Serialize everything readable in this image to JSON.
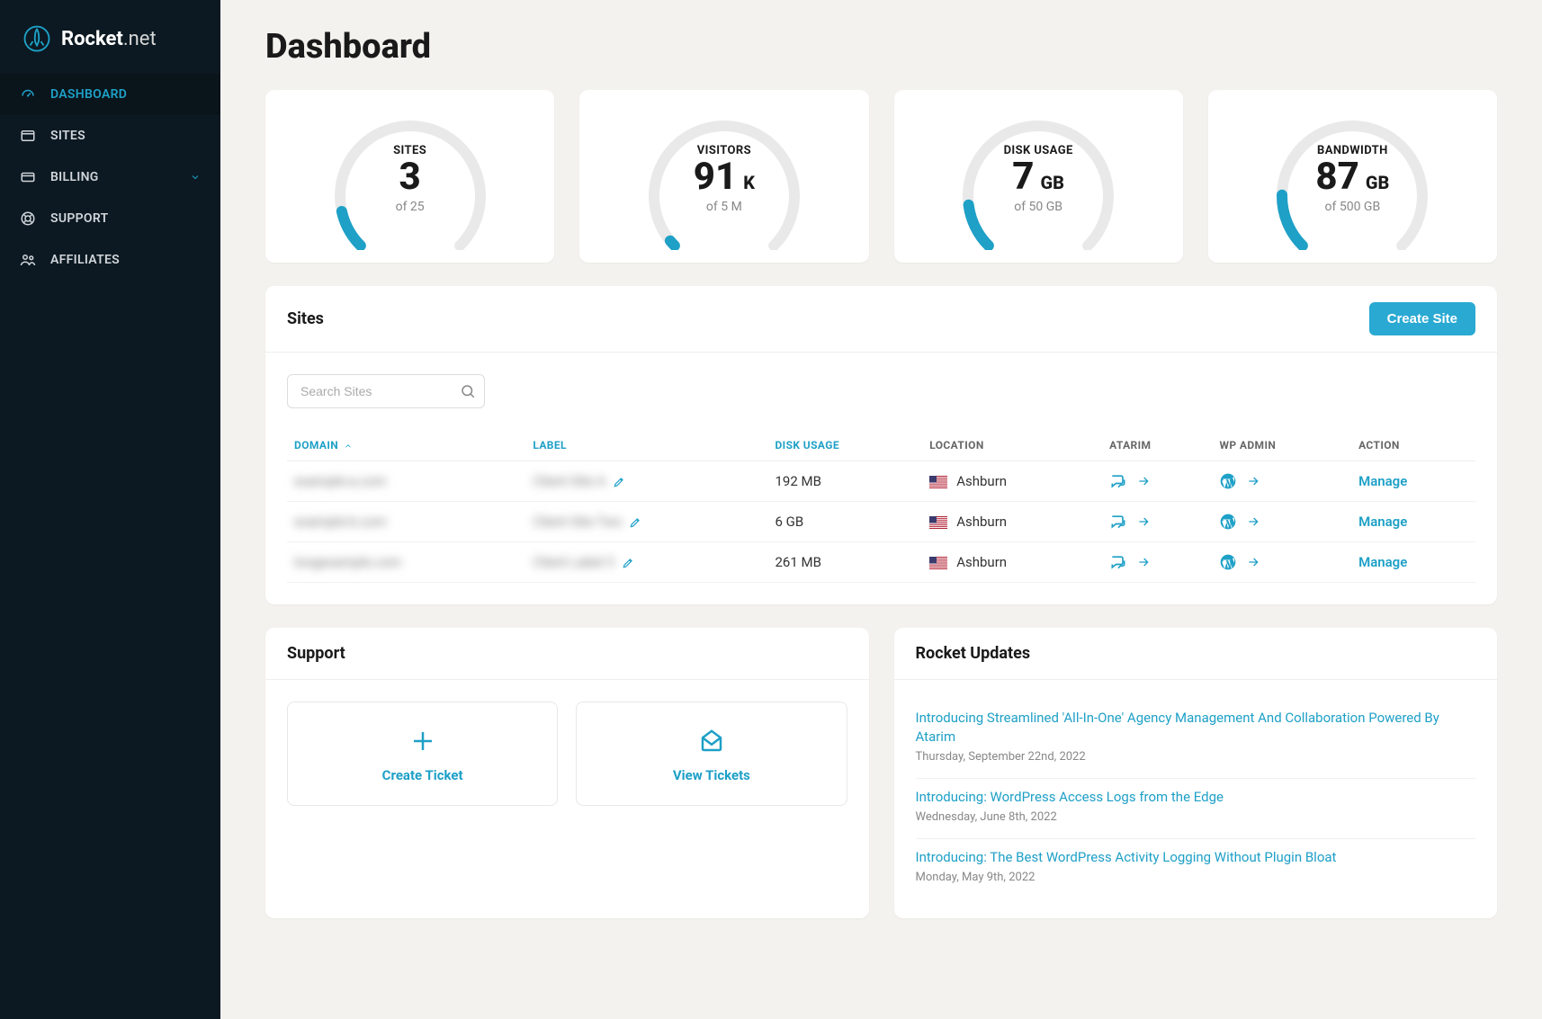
{
  "brand": {
    "name_bold": "Rocket",
    "name_thin": ".net"
  },
  "nav": [
    {
      "label": "DASHBOARD",
      "icon": "gauge",
      "active": true
    },
    {
      "label": "SITES",
      "icon": "window",
      "active": false
    },
    {
      "label": "BILLING",
      "icon": "card",
      "active": false,
      "expandable": true
    },
    {
      "label": "SUPPORT",
      "icon": "lifebuoy",
      "active": false
    },
    {
      "label": "AFFILIATES",
      "icon": "people",
      "active": false
    }
  ],
  "page_title": "Dashboard",
  "chart_data": [
    {
      "type": "gauge",
      "label": "SITES",
      "value": "3",
      "unit": "",
      "sub": "of 25",
      "fraction": 0.12
    },
    {
      "type": "gauge",
      "label": "VISITORS",
      "value": "91",
      "unit": "K",
      "sub": "of 5 M",
      "fraction": 0.02
    },
    {
      "type": "gauge",
      "label": "DISK USAGE",
      "value": "7",
      "unit": "GB",
      "sub": "of 50 GB",
      "fraction": 0.14
    },
    {
      "type": "gauge",
      "label": "BANDWIDTH",
      "value": "87",
      "unit": "GB",
      "sub": "of 500 GB",
      "fraction": 0.17
    }
  ],
  "sites_panel": {
    "title": "Sites",
    "create_btn": "Create Site",
    "search_placeholder": "Search Sites",
    "headers": {
      "domain": "DOMAIN",
      "label": "LABEL",
      "disk": "DISK USAGE",
      "location": "LOCATION",
      "atarim": "ATARIM",
      "wpadmin": "WP ADMIN",
      "action": "ACTION"
    },
    "rows": [
      {
        "domain": "example-a.com",
        "label": "Client Site A",
        "disk": "192 MB",
        "location": "Ashburn",
        "manage": "Manage"
      },
      {
        "domain": "example-b.com",
        "label": "Client Site Two",
        "disk": "6 GB",
        "location": "Ashburn",
        "manage": "Manage"
      },
      {
        "domain": "longexample.com",
        "label": "Client Label 3",
        "disk": "261 MB",
        "location": "Ashburn",
        "manage": "Manage"
      }
    ]
  },
  "support_panel": {
    "title": "Support",
    "create": "Create Ticket",
    "view": "View Tickets"
  },
  "updates_panel": {
    "title": "Rocket Updates",
    "items": [
      {
        "title": "Introducing Streamlined 'All-In-One' Agency Management And Collaboration Powered By Atarim",
        "date": "Thursday, September 22nd, 2022"
      },
      {
        "title": "Introducing: WordPress Access Logs from the Edge",
        "date": "Wednesday, June 8th, 2022"
      },
      {
        "title": "Introducing: The Best WordPress Activity Logging Without Plugin Bloat",
        "date": "Monday, May 9th, 2022"
      }
    ]
  },
  "colors": {
    "accent": "#1ea0c7"
  }
}
